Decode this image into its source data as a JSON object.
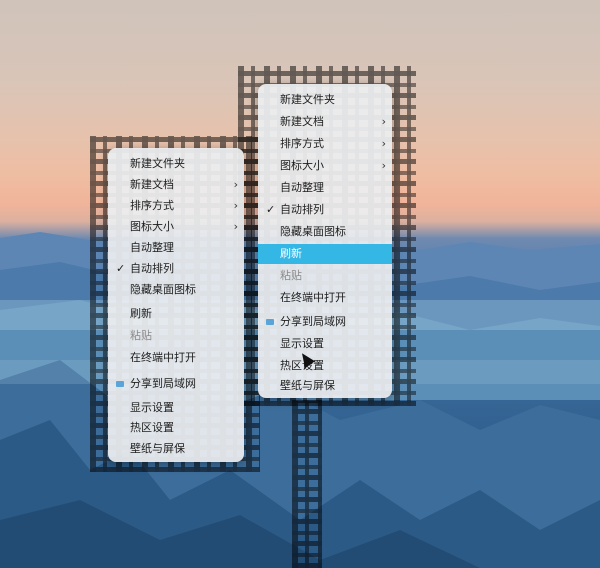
{
  "menu_left": {
    "items": [
      {
        "label": "新建文件夹",
        "submenu": false,
        "checked": false,
        "disabled": false,
        "icon": ""
      },
      {
        "label": "新建文档",
        "submenu": true,
        "checked": false,
        "disabled": false,
        "icon": ""
      },
      {
        "label": "排序方式",
        "submenu": true,
        "checked": false,
        "disabled": false,
        "icon": ""
      },
      {
        "label": "图标大小",
        "submenu": true,
        "checked": false,
        "disabled": false,
        "icon": ""
      },
      {
        "label": "自动整理",
        "submenu": false,
        "checked": false,
        "disabled": false,
        "icon": ""
      },
      {
        "label": "自动排列",
        "submenu": false,
        "checked": true,
        "disabled": false,
        "icon": ""
      },
      {
        "label": "隐藏桌面图标",
        "submenu": false,
        "checked": false,
        "disabled": false,
        "icon": ""
      },
      {
        "label": "刷新",
        "submenu": false,
        "checked": false,
        "disabled": false,
        "icon": ""
      },
      {
        "label": "粘贴",
        "submenu": false,
        "checked": false,
        "disabled": true,
        "icon": ""
      },
      {
        "label": "在终端中打开",
        "submenu": false,
        "checked": false,
        "disabled": false,
        "icon": ""
      },
      {
        "label": "分享到局域网",
        "submenu": false,
        "checked": false,
        "disabled": false,
        "icon": "share-icon"
      },
      {
        "label": "显示设置",
        "submenu": false,
        "checked": false,
        "disabled": false,
        "icon": ""
      },
      {
        "label": "热区设置",
        "submenu": false,
        "checked": false,
        "disabled": false,
        "icon": ""
      },
      {
        "label": "壁纸与屏保",
        "submenu": false,
        "checked": false,
        "disabled": false,
        "icon": ""
      }
    ]
  },
  "menu_right": {
    "highlighted_index": 7,
    "items": [
      {
        "label": "新建文件夹",
        "submenu": false,
        "checked": false,
        "disabled": false,
        "icon": ""
      },
      {
        "label": "新建文档",
        "submenu": true,
        "checked": false,
        "disabled": false,
        "icon": ""
      },
      {
        "label": "排序方式",
        "submenu": true,
        "checked": false,
        "disabled": false,
        "icon": ""
      },
      {
        "label": "图标大小",
        "submenu": true,
        "checked": false,
        "disabled": false,
        "icon": ""
      },
      {
        "label": "自动整理",
        "submenu": false,
        "checked": false,
        "disabled": false,
        "icon": ""
      },
      {
        "label": "自动排列",
        "submenu": false,
        "checked": true,
        "disabled": false,
        "icon": ""
      },
      {
        "label": "隐藏桌面图标",
        "submenu": false,
        "checked": false,
        "disabled": false,
        "icon": ""
      },
      {
        "label": "刷新",
        "submenu": false,
        "checked": false,
        "disabled": false,
        "icon": ""
      },
      {
        "label": "粘贴",
        "submenu": false,
        "checked": false,
        "disabled": true,
        "icon": ""
      },
      {
        "label": "在终端中打开",
        "submenu": false,
        "checked": false,
        "disabled": false,
        "icon": ""
      },
      {
        "label": "分享到局域网",
        "submenu": false,
        "checked": false,
        "disabled": false,
        "icon": "share-icon"
      },
      {
        "label": "显示设置",
        "submenu": false,
        "checked": false,
        "disabled": false,
        "icon": ""
      },
      {
        "label": "热区设置",
        "submenu": false,
        "checked": false,
        "disabled": false,
        "icon": ""
      },
      {
        "label": "壁纸与屏保",
        "submenu": false,
        "checked": false,
        "disabled": false,
        "icon": ""
      }
    ]
  },
  "glyphs": {
    "submenu": "›",
    "check": "✓"
  },
  "colors": {
    "highlight": "#35b7e6",
    "menu_bg": "#eceef0",
    "disabled_text": "#8a8a8a"
  }
}
